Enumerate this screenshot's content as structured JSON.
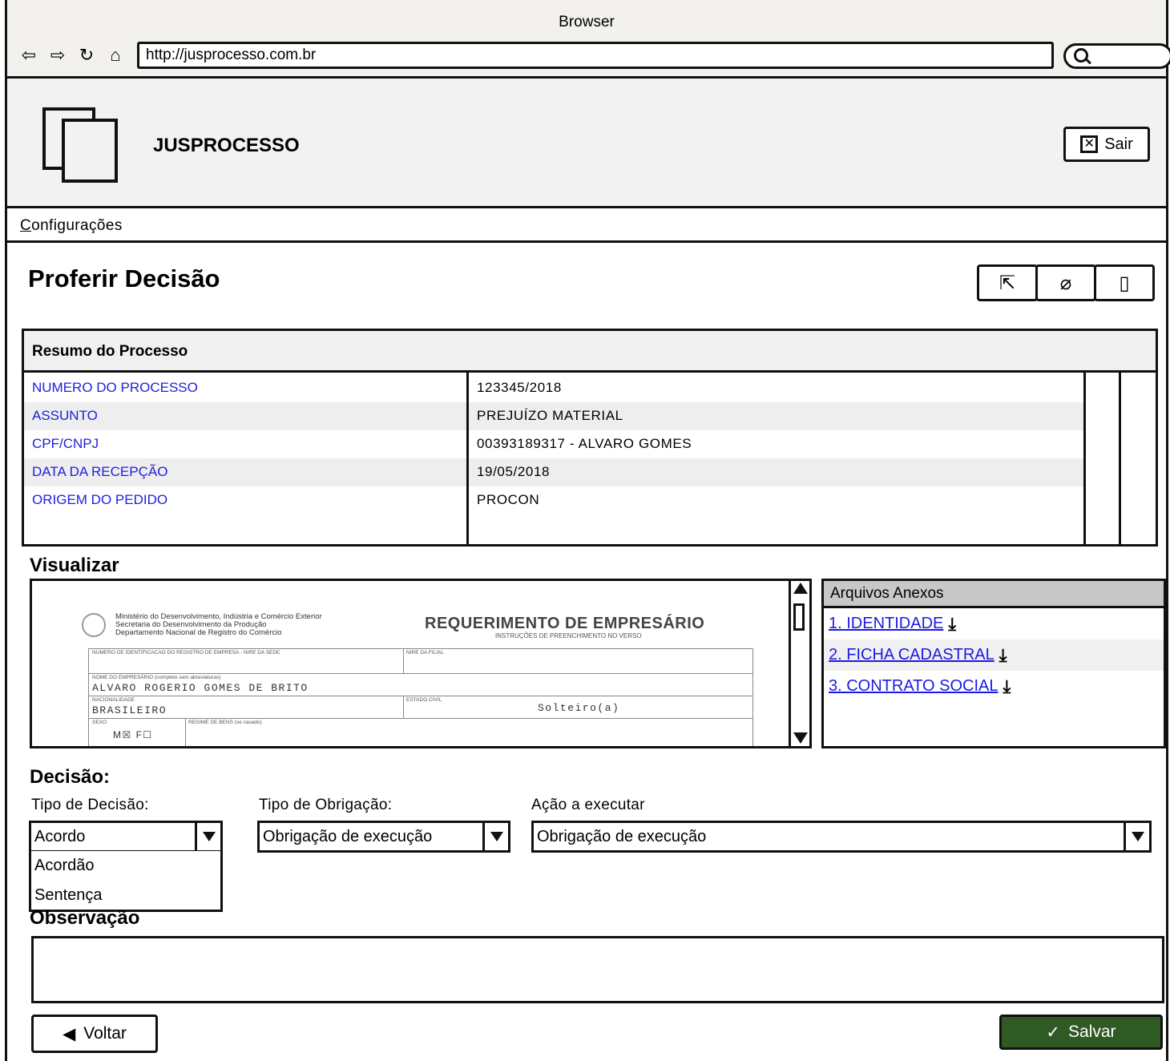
{
  "browser": {
    "title": "Browser",
    "url": "http://jusprocesso.com.br",
    "icons": [
      "back-arrow-icon",
      "forward-arrow-icon",
      "reload-icon",
      "home-icon",
      "search-icon"
    ]
  },
  "app": {
    "name": "JUSPROCESSO",
    "logout_label": "Sair"
  },
  "menu": {
    "first_letter": "C",
    "rest": "onfigurações"
  },
  "page": {
    "title": "Proferir Decisão",
    "tool_icons": [
      "share-icon",
      "attach-icon",
      "document-icon"
    ]
  },
  "resumo": {
    "header": "Resumo do Processo",
    "rows": [
      {
        "label": "NUMERO DO PROCESSO",
        "value": "123345/2018"
      },
      {
        "label": "ASSUNTO",
        "value": "PREJUÍZO MATERIAL"
      },
      {
        "label": "CPF/CNPJ",
        "value": " 00393189317  -  ALVARO GOMES"
      },
      {
        "label": "DATA DA RECEPÇÃO",
        "value": "19/05/2018"
      },
      {
        "label": "ORIGEM DO PEDIDO",
        "value": "PROCON"
      }
    ]
  },
  "visualizar": {
    "label": "Visualizar",
    "doc": {
      "ministry_line1": "Ministério do Desenvolvimento, Indústria e Comércio Exterior",
      "ministry_line2": "Secretaria do Desenvolvimento da Produção",
      "ministry_line3": "Departamento Nacional de Registro do Comércio",
      "title": "REQUERIMENTO DE EMPRESÁRIO",
      "subtitle": "INSTRUÇÕES DE PREENCHIMENTO NO VERSO",
      "field_nire": "NUMERO DE IDENTIFICACAO DO REGISTRO DE EMPRESA - NIRE DA SEDE",
      "field_filial": "NIRE DA FILIAL",
      "field_nome": "NOME DO EMPRESÁRIO (completo sem abreviaturas)",
      "nome_value": "ALVARO ROGERIO GOMES DE BRITO",
      "field_nac": "NACIONALIDADE",
      "nac_value": "BRASILEIRO",
      "field_civil": "ESTADO CIVIL",
      "civil_value": "Solteiro(a)",
      "field_sexo": "SEXO",
      "sexo_value": "M☒ F☐",
      "field_regime": "REGIME DE BENS (se casado)"
    }
  },
  "anexos": {
    "header": "Arquivos Anexos",
    "items": [
      {
        "label": "1. IDENTIDADE"
      },
      {
        "label": "2. FICHA CADASTRAL"
      },
      {
        "label": "3. CONTRATO SOCIAL"
      }
    ]
  },
  "decisao": {
    "label": "Decisão:",
    "tipo_decisao": {
      "label": "Tipo de Decisão:",
      "value": "Acordo",
      "options": [
        "Acordão",
        "Sentença"
      ]
    },
    "tipo_obrigacao": {
      "label": "Tipo de Obrigação:",
      "value": "Obrigação de execução"
    },
    "acao": {
      "label": "Ação a executar",
      "value": "Obrigação de execução"
    }
  },
  "observacao": {
    "label": "Observação",
    "value": ""
  },
  "actions": {
    "back_label": "Voltar",
    "save_label": "Salvar",
    "save_color": "#2f5a23"
  }
}
